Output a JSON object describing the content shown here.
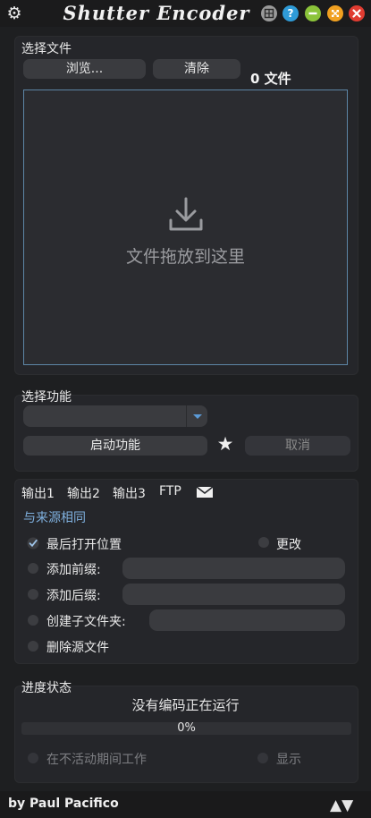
{
  "titlebar": {
    "title": "Shutter Encoder",
    "help_glyph": "?",
    "icons": [
      "gear-icon",
      "layout-icon",
      "help-icon",
      "minimize-icon",
      "maximize-icon",
      "close-icon"
    ],
    "colors": {
      "help": "#2f9bd7",
      "minimize": "#8bc33a",
      "maximize": "#f0a020",
      "close": "#e03c31"
    }
  },
  "files": {
    "section_title": "选择文件",
    "browse_label": "浏览...",
    "clear_label": "清除",
    "count_label": "0 文件",
    "drop_text": "文件拖放到这里",
    "drop_icon": "download-icon"
  },
  "function": {
    "section_title": "选择功能",
    "selected": "",
    "start_label": "启动功能",
    "cancel_label": "取消",
    "favorite_icon": "star-icon"
  },
  "output": {
    "tabs": [
      "输出1",
      "输出2",
      "输出3",
      "FTP"
    ],
    "mail_icon": "mail-icon",
    "same_source_label": "与来源相同",
    "options": {
      "last_open": {
        "label": "最后打开位置",
        "checked": true
      },
      "change": {
        "label": "更改",
        "checked": false
      },
      "prefix": {
        "label": "添加前缀:",
        "checked": false,
        "value": ""
      },
      "suffix": {
        "label": "添加后缀:",
        "checked": false,
        "value": ""
      },
      "subfolder": {
        "label": "创建子文件夹:",
        "checked": false,
        "value": ""
      },
      "delete_source": {
        "label": "删除源文件",
        "checked": false
      }
    }
  },
  "progress": {
    "section_title": "进度状态",
    "status": "没有编码正在运行",
    "percent_text": "0%",
    "percent": 0,
    "work_inactive_label": "在不活动期间工作",
    "show_label": "显示"
  },
  "footer": {
    "byline": "by Paul Pacifico",
    "arrows": "▲▼"
  },
  "colors": {
    "accent": "#4d8fcf",
    "link": "#7fb0de",
    "background": "#1e1f21"
  }
}
